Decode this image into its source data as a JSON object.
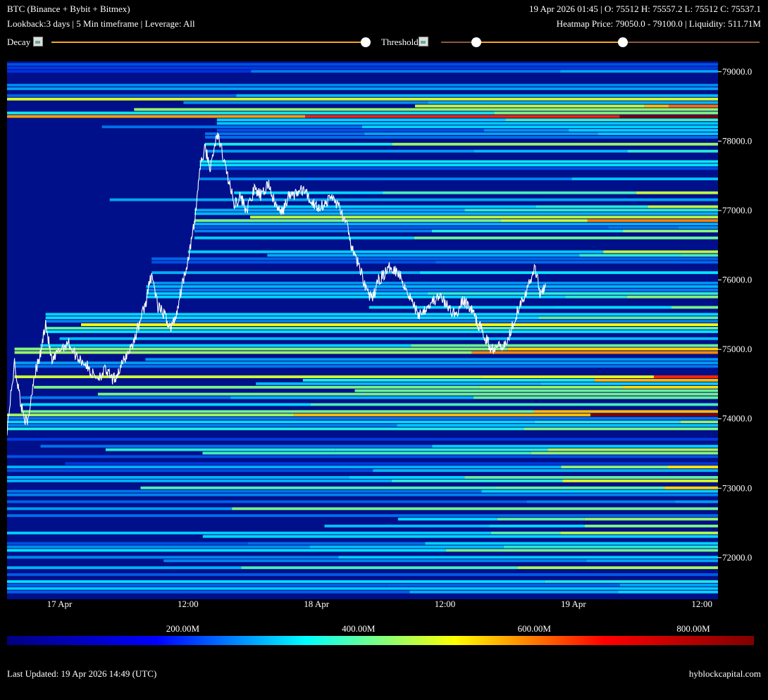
{
  "header": {
    "title": "BTC (Binance + Bybit + Bitmex)",
    "ohlc": "19 Apr 2026 01:45 | O: 75512 H: 75557.2 L: 75512 C: 75537.1",
    "settings": "Lookback:3 days | 5 Min timeframe | Leverage: All",
    "heatmap_info": "Heatmap Price: 79050.0 - 79100.0 | Liquidity: 511.71M"
  },
  "controls": {
    "decay_label": "Decay",
    "threshold_label": "Threshold",
    "decay_value": 1.0,
    "threshold_range": [
      0.11,
      0.57
    ],
    "slider_color": "#f5a623",
    "slider_inactive_color": "#8b5a3c"
  },
  "footer": {
    "last_updated": "Last Updated: 19 Apr 2026 14:49 (UTC)",
    "site": "hyblockcapital.com"
  },
  "colors": {
    "background": "#000000",
    "heatmap_base": "#00108a",
    "price_line": "#ffffff"
  },
  "chart_data": {
    "type": "heatmap",
    "y_ticks": [
      "72000.0",
      "73000.0",
      "74000.0",
      "75000.0",
      "76000.0",
      "77000.0",
      "78000.0",
      "79000.0"
    ],
    "y_tick_values": [
      72000,
      73000,
      74000,
      75000,
      76000,
      77000,
      78000,
      79000
    ],
    "ylim": [
      71400,
      79150
    ],
    "x_ticks": [
      "17 Apr",
      "12:00",
      "18 Apr",
      "12:00",
      "19 Apr",
      "12:00"
    ],
    "x_tick_values": [
      24,
      36,
      48,
      60,
      72,
      84
    ],
    "xlim": [
      19.1,
      85.5
    ],
    "colorbar": {
      "ticks": [
        "200.00M",
        "400.00M",
        "600.00M",
        "800.00M"
      ],
      "tick_values": [
        200,
        400,
        600,
        800
      ],
      "range": [
        0,
        850
      ],
      "stops": [
        "#000080",
        "#0000ff",
        "#00ffff",
        "#ffff00",
        "#ff0000",
        "#800000"
      ]
    },
    "price_series": [
      [
        19.1,
        73850
      ],
      [
        19.8,
        74800
      ],
      [
        20.4,
        74200
      ],
      [
        21.0,
        73900
      ],
      [
        21.6,
        74600
      ],
      [
        22.2,
        74900
      ],
      [
        22.7,
        75400
      ],
      [
        23.3,
        74800
      ],
      [
        24.0,
        75000
      ],
      [
        24.8,
        75100
      ],
      [
        25.6,
        74900
      ],
      [
        26.4,
        74800
      ],
      [
        27.0,
        74650
      ],
      [
        27.6,
        74600
      ],
      [
        28.3,
        74700
      ],
      [
        29.0,
        74550
      ],
      [
        29.6,
        74700
      ],
      [
        30.2,
        74900
      ],
      [
        30.9,
        75100
      ],
      [
        31.5,
        75400
      ],
      [
        32.1,
        75700
      ],
      [
        32.6,
        76100
      ],
      [
        33.2,
        75600
      ],
      [
        33.8,
        75500
      ],
      [
        34.4,
        75300
      ],
      [
        34.9,
        75500
      ],
      [
        35.4,
        75900
      ],
      [
        36.0,
        76300
      ],
      [
        36.6,
        76800
      ],
      [
        37.1,
        77600
      ],
      [
        37.6,
        77900
      ],
      [
        38.1,
        77600
      ],
      [
        38.7,
        78100
      ],
      [
        39.1,
        77900
      ],
      [
        39.7,
        77500
      ],
      [
        40.3,
        77100
      ],
      [
        40.9,
        77200
      ],
      [
        41.5,
        77000
      ],
      [
        42.2,
        77300
      ],
      [
        42.9,
        77200
      ],
      [
        43.5,
        77400
      ],
      [
        44.1,
        77100
      ],
      [
        44.7,
        76950
      ],
      [
        45.4,
        77200
      ],
      [
        46.1,
        77250
      ],
      [
        46.8,
        77300
      ],
      [
        47.4,
        77150
      ],
      [
        48.1,
        77050
      ],
      [
        48.8,
        77100
      ],
      [
        49.5,
        77200
      ],
      [
        50.1,
        77050
      ],
      [
        50.8,
        76800
      ],
      [
        51.4,
        76400
      ],
      [
        52.0,
        76200
      ],
      [
        52.6,
        75900
      ],
      [
        53.2,
        75700
      ],
      [
        53.8,
        76000
      ],
      [
        54.4,
        76100
      ],
      [
        55.0,
        76200
      ],
      [
        55.7,
        76100
      ],
      [
        56.3,
        75900
      ],
      [
        56.9,
        75700
      ],
      [
        57.5,
        75500
      ],
      [
        58.2,
        75600
      ],
      [
        58.9,
        75700
      ],
      [
        59.6,
        75750
      ],
      [
        60.3,
        75600
      ],
      [
        61.0,
        75500
      ],
      [
        61.7,
        75700
      ],
      [
        62.4,
        75600
      ],
      [
        63.0,
        75400
      ],
      [
        63.7,
        75200
      ],
      [
        64.3,
        75000
      ],
      [
        65.0,
        75100
      ],
      [
        65.7,
        75050
      ],
      [
        66.4,
        75400
      ],
      [
        67.1,
        75700
      ],
      [
        67.8,
        75900
      ],
      [
        68.4,
        76200
      ],
      [
        68.9,
        75800
      ],
      [
        69.4,
        75950
      ]
    ]
  }
}
